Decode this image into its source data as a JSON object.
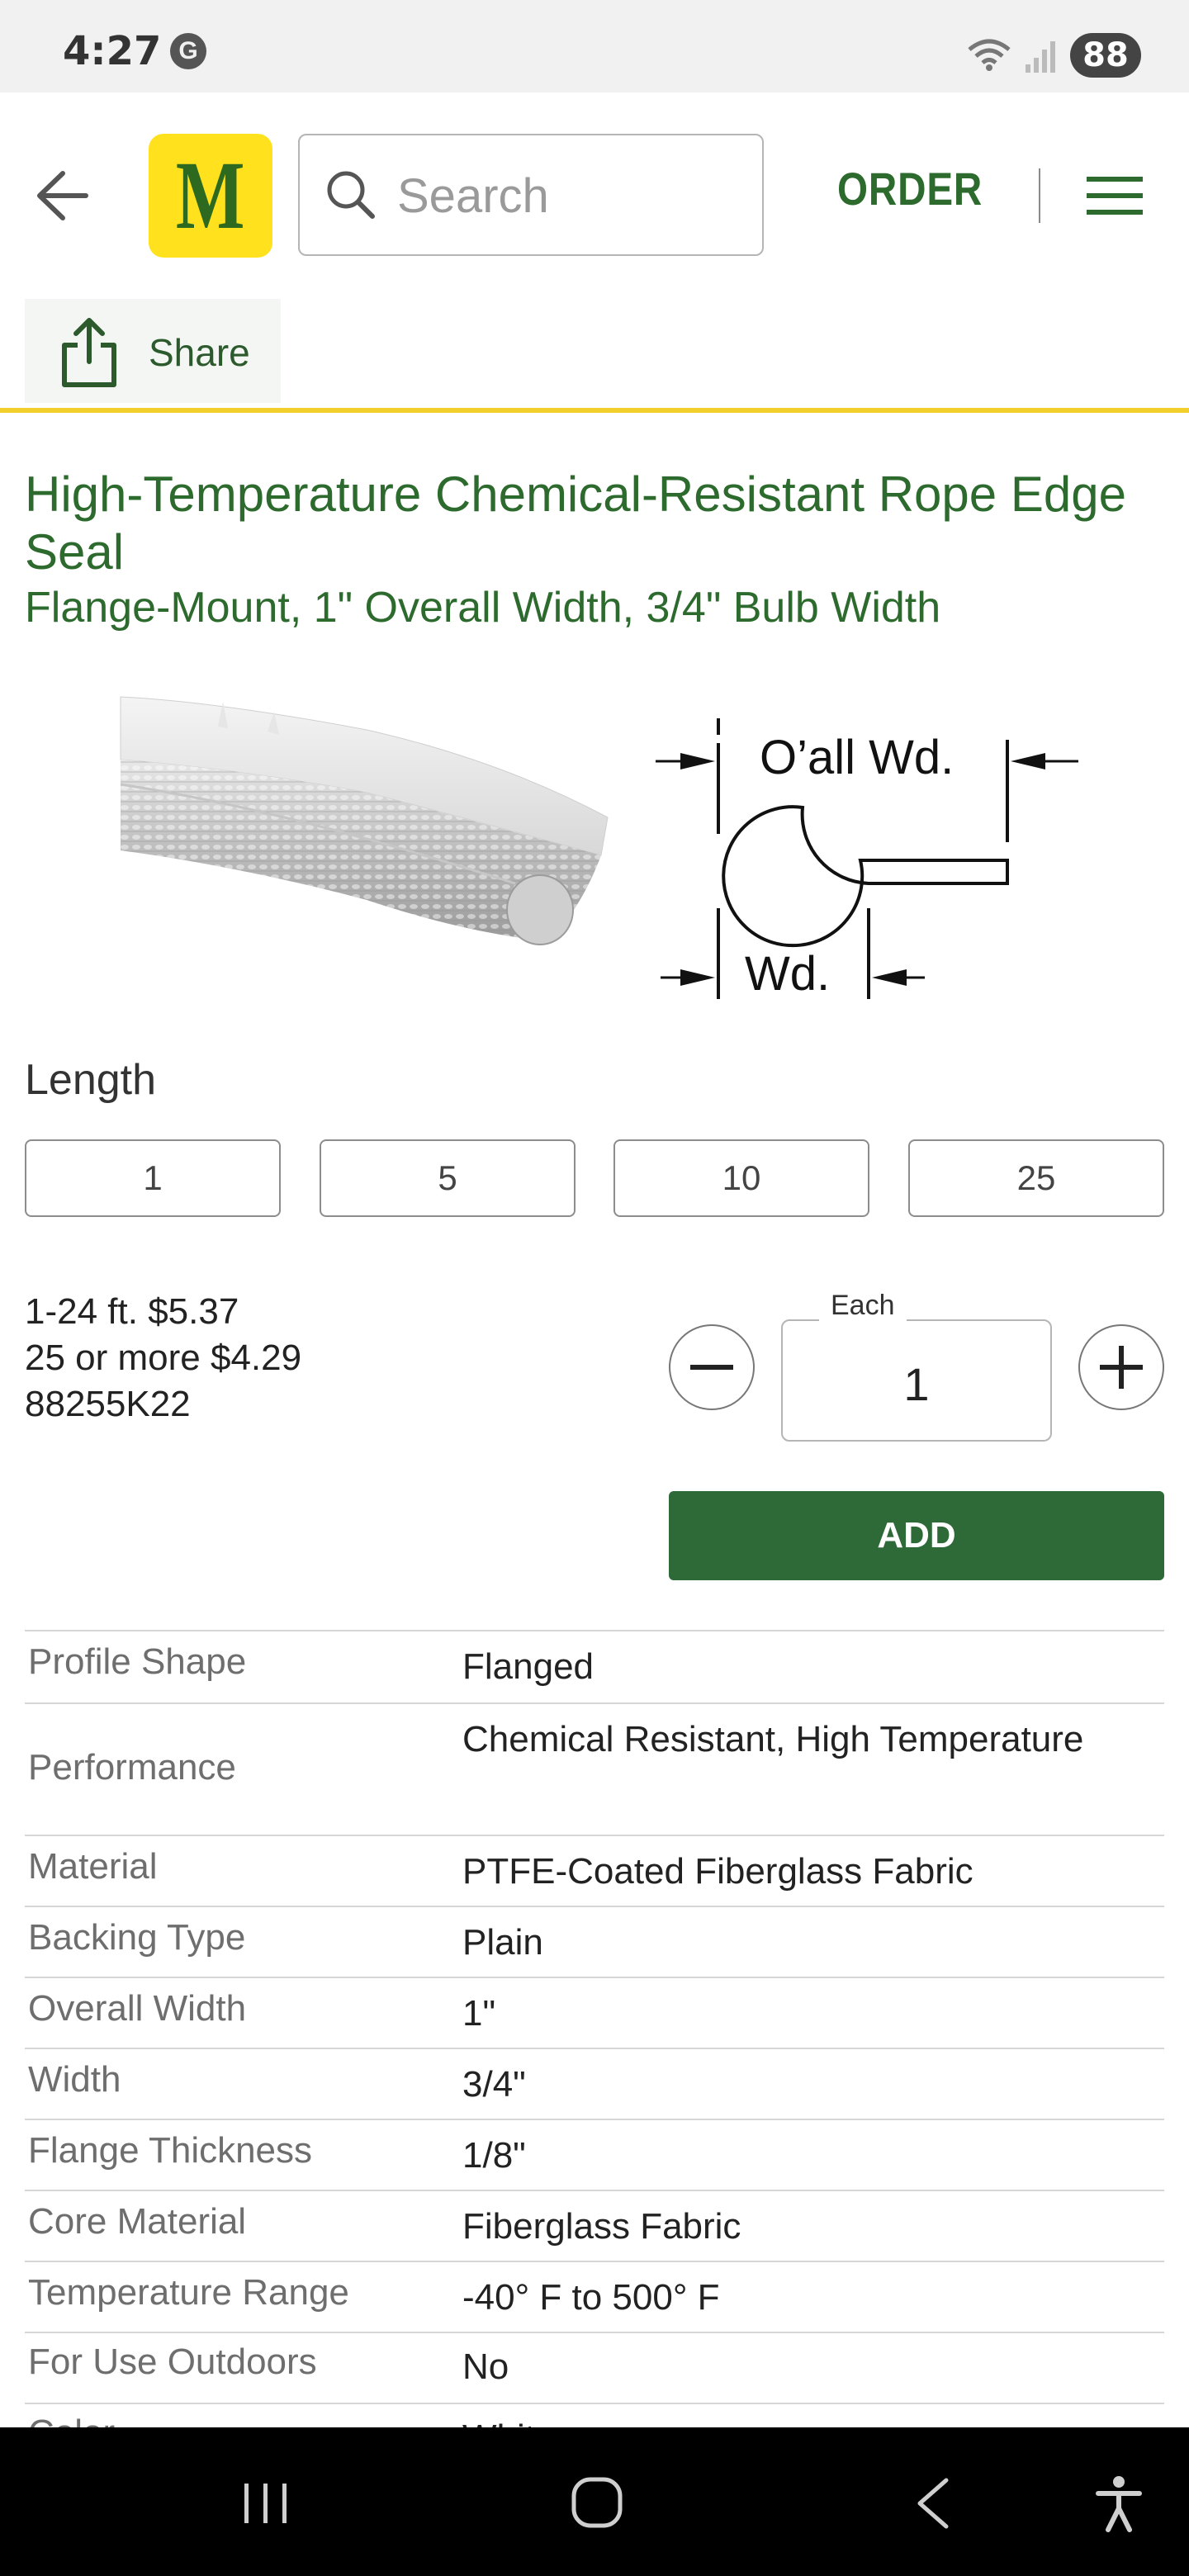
{
  "status_bar": {
    "time": "4:27",
    "g_badge": "G",
    "battery": "88"
  },
  "header": {
    "logo_letter": "M",
    "search_placeholder": "Search",
    "order_label": "ORDER",
    "share_label": "Share"
  },
  "product": {
    "title": "High-Temperature Chemical-Resistant Rope Edge Seal",
    "subtitle": "Flange-Mount, 1\" Overall Width, 3/4\" Bulb Width",
    "diagram_labels": {
      "overall_width": "O’all Wd.",
      "width": "Wd."
    }
  },
  "length": {
    "label": "Length",
    "options": [
      "1",
      "5",
      "10",
      "25"
    ]
  },
  "pricing": {
    "tier1": "1-24 ft. $5.37",
    "tier2": "25 or more $4.29",
    "part_number": "88255K22",
    "unit_label": "Each",
    "quantity": "1",
    "add_label": "ADD"
  },
  "specs": [
    {
      "key": "Profile Shape",
      "value": "Flanged"
    },
    {
      "key": "Performance",
      "value": "Chemical Resistant, High Temperature"
    },
    {
      "key": "Material",
      "value": "PTFE-Coated Fiberglass Fabric"
    },
    {
      "key": "Backing Type",
      "value": "Plain"
    },
    {
      "key": "Overall Width",
      "value": "1\""
    },
    {
      "key": "Width",
      "value": "3/4\""
    },
    {
      "key": "Flange Thickness",
      "value": "1/8\""
    },
    {
      "key": "Core Material",
      "value": "Fiberglass Fabric"
    },
    {
      "key": "Temperature Range",
      "value": "-40° F to 500° F"
    },
    {
      "key": "For Use Outdoors",
      "value": "No"
    },
    {
      "key": "Color",
      "value": "White"
    }
  ],
  "colors": {
    "brand_green": "#2d6a2d",
    "brand_yellow": "#ffe21d",
    "add_button": "#2e6a38"
  }
}
